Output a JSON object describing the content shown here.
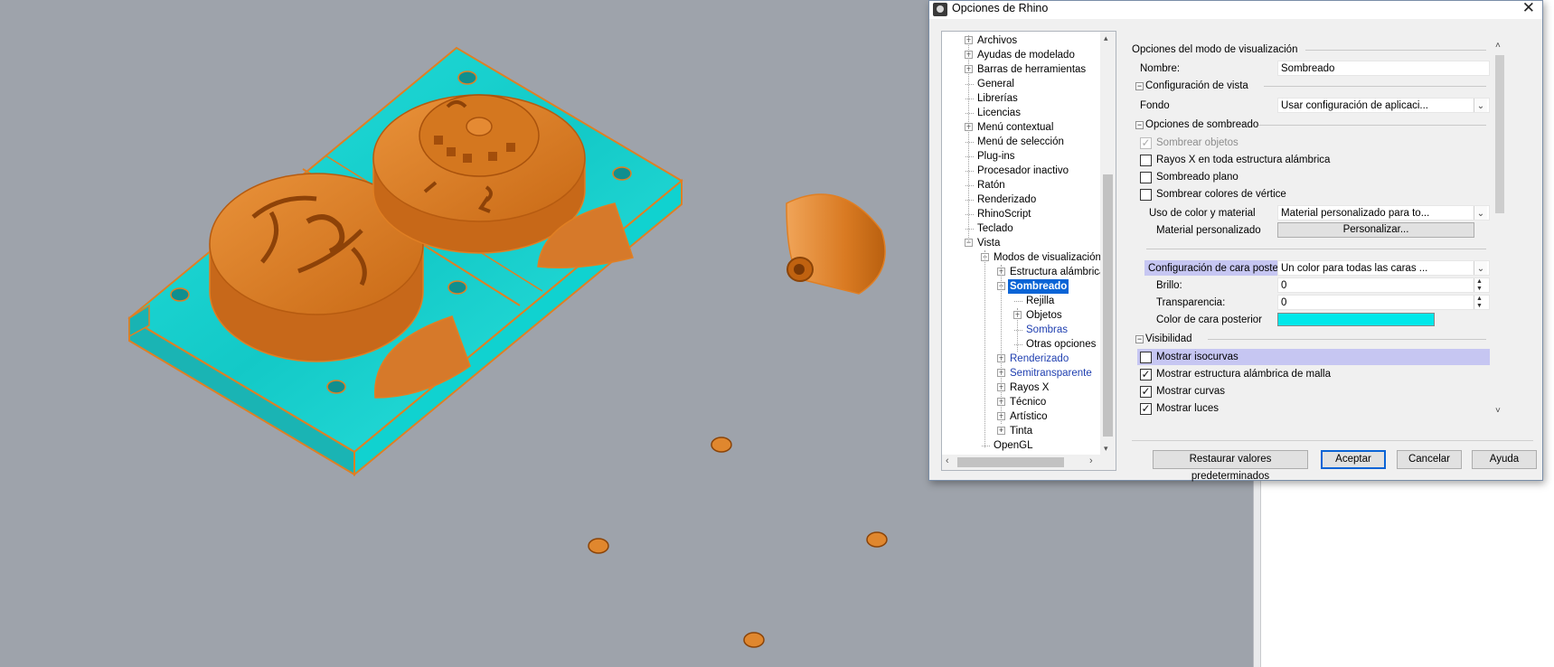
{
  "dialog": {
    "title": "Opciones de Rhino",
    "close_glyph": "✕"
  },
  "tree": {
    "items": [
      {
        "label": "Archivos",
        "expander": "+"
      },
      {
        "label": "Ayudas de modelado",
        "expander": "+"
      },
      {
        "label": "Barras de herramientas",
        "expander": "+"
      },
      {
        "label": "General"
      },
      {
        "label": "Librerías"
      },
      {
        "label": "Licencias"
      },
      {
        "label": "Menú contextual",
        "expander": "+"
      },
      {
        "label": "Menú de selección"
      },
      {
        "label": "Plug-ins"
      },
      {
        "label": "Procesador inactivo"
      },
      {
        "label": "Ratón"
      },
      {
        "label": "Renderizado"
      },
      {
        "label": "RhinoScript"
      },
      {
        "label": "Teclado"
      },
      {
        "label": "Vista",
        "expander": "−"
      },
      {
        "label": "Modos de visualización",
        "expander": "−"
      },
      {
        "label": "Estructura alámbrica",
        "expander": "+"
      },
      {
        "label": "Sombreado",
        "expander": "−",
        "selected": true
      },
      {
        "label": "Rejilla"
      },
      {
        "label": "Objetos",
        "expander": "+"
      },
      {
        "label": "Sombras",
        "style": "blue"
      },
      {
        "label": "Otras opciones"
      },
      {
        "label": "Renderizado",
        "expander": "+",
        "style": "blue"
      },
      {
        "label": "Semitransparente",
        "expander": "+",
        "style": "blue"
      },
      {
        "label": "Rayos X",
        "expander": "+"
      },
      {
        "label": "Técnico",
        "expander": "+"
      },
      {
        "label": "Artístico",
        "expander": "+"
      },
      {
        "label": "Tinta",
        "expander": "+"
      },
      {
        "label": "OpenGL"
      }
    ],
    "scroll_left": "‹",
    "scroll_right": "›",
    "scroll_up": "▴",
    "scroll_down": "▾"
  },
  "options": {
    "header": "Opciones del modo de visualización",
    "nombre_label": "Nombre:",
    "nombre_value": "Sombreado",
    "sec_vista": "Configuración de vista",
    "fondo_label": "Fondo",
    "fondo_value": "Usar configuración de aplicaci...",
    "sec_sombreado": "Opciones de sombreado",
    "sombrear_objetos": "Sombrear objetos",
    "rayos_x": "Rayos X en toda estructura alámbrica",
    "sombreado_plano": "Sombreado plano",
    "colores_vertice": "Sombrear colores de vértice",
    "uso_color_label": "Uso de color y material",
    "uso_color_value": "Material personalizado para to...",
    "material_label": "Material personalizado",
    "personalizar_btn": "Personalizar...",
    "cara_posterior_label": "Configuración de cara posterior",
    "cara_posterior_value": "Un color para todas las caras ...",
    "brillo_label": "Brillo:",
    "brillo_value": "0",
    "transparencia_label": "Transparencia:",
    "transparencia_value": "0",
    "color_cara_label": "Color de cara posterior",
    "color_cara_value": "#00e8ea",
    "sec_visibilidad": "Visibilidad",
    "mostrar_isocurvas": "Mostrar isocurvas",
    "mostrar_malla": "Mostrar estructura alámbrica de malla",
    "mostrar_curvas": "Mostrar curvas",
    "mostrar_luces": "Mostrar luces",
    "collapse_glyph": "−",
    "check_glyph": "✓",
    "combo_arrow": "⌄",
    "spin_up": "▲",
    "spin_down": "▼",
    "scroll_up": "˄",
    "scroll_down": "˅"
  },
  "buttons": {
    "restaurar": "Restaurar valores predeterminados",
    "aceptar": "Aceptar",
    "cancelar": "Cancelar",
    "ayuda": "Ayuda"
  },
  "colors": {
    "viewport_bg": "#9ea3ab",
    "model_orange": "#e07f23",
    "model_cyan": "#19d9d6",
    "selection_blue": "#0a64d6",
    "highlight_row": "#c6c6f2"
  }
}
